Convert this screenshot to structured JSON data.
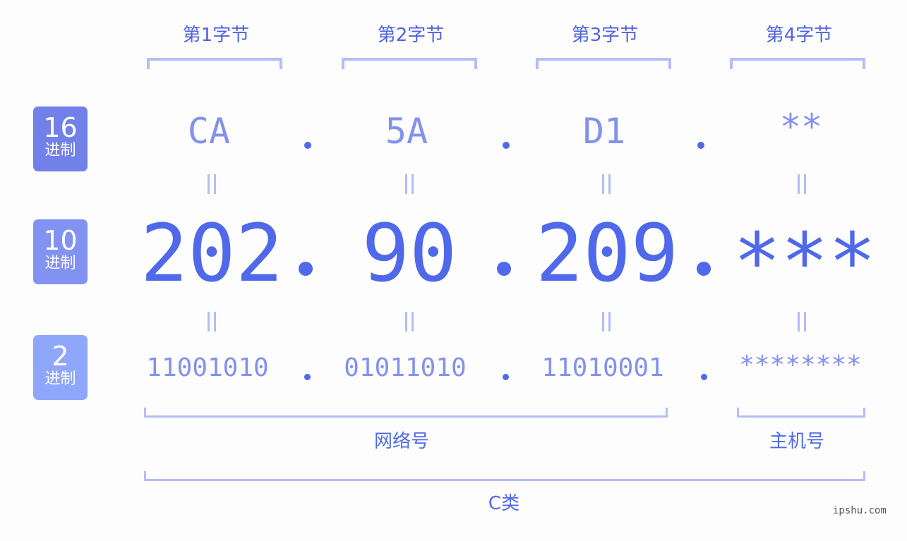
{
  "bytes": [
    {
      "header": "第1字节",
      "hex": "CA",
      "dec": "202",
      "bin": "11001010"
    },
    {
      "header": "第2字节",
      "hex": "5A",
      "dec": "90",
      "bin": "01011010"
    },
    {
      "header": "第3字节",
      "hex": "D1",
      "dec": "209",
      "bin": "11010001"
    },
    {
      "header": "第4字节",
      "hex": "**",
      "dec": "***",
      "bin": "********"
    }
  ],
  "badges": {
    "hex": {
      "num": "16",
      "unit": "进制"
    },
    "dec": {
      "num": "10",
      "unit": "进制"
    },
    "bin": {
      "num": "2",
      "unit": "进制"
    }
  },
  "groups": {
    "network": "网络号",
    "host": "主机号",
    "class": "C类"
  },
  "watermark": "ipshu.com",
  "colors": {
    "primary": "#5068ea",
    "light": "#8391ee",
    "bracket": "#b4bdf7",
    "badge16": "#7280ea",
    "badge10": "#8292f3",
    "badge2": "#8fa7fb"
  }
}
